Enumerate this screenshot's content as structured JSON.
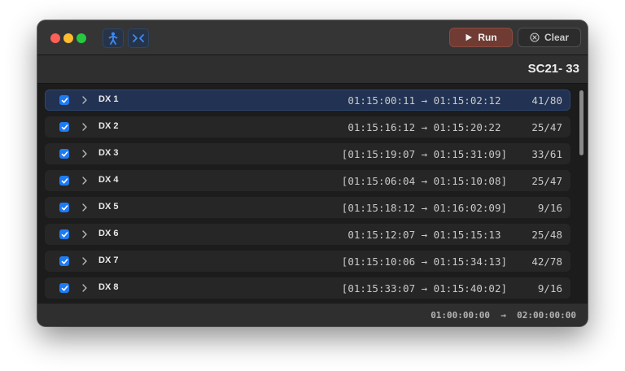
{
  "toolbar": {
    "run_label": "Run",
    "clear_label": "Clear"
  },
  "header": {
    "scene_title": "SC21- 33"
  },
  "list": {
    "rows": [
      {
        "name": "DX 1",
        "range": " 01:15:00:11 → 01:15:02:12 ",
        "count": "41/80",
        "checked": true,
        "selected": true
      },
      {
        "name": "DX 2",
        "range": " 01:15:16:12 → 01:15:20:22 ",
        "count": "25/47",
        "checked": true
      },
      {
        "name": "DX 3",
        "range": "[01:15:19:07 → 01:15:31:09]",
        "count": "33/61",
        "checked": true
      },
      {
        "name": "DX 4",
        "range": "[01:15:06:04 → 01:15:10:08]",
        "count": "25/47",
        "checked": true
      },
      {
        "name": "DX 5",
        "range": "[01:15:18:12 → 01:16:02:09]",
        "count": "9/16",
        "checked": true
      },
      {
        "name": "DX 6",
        "range": " 01:15:12:07 → 01:15:15:13 ",
        "count": "25/48",
        "checked": true
      },
      {
        "name": "DX 7",
        "range": "[01:15:10:06 → 01:15:34:13]",
        "count": "42/78",
        "checked": true
      },
      {
        "name": "DX 8",
        "range": "[01:15:33:07 → 01:15:40:02]",
        "count": "9/16",
        "checked": true
      }
    ]
  },
  "footer": {
    "range": "01:00:00:00  →  02:00:00:00"
  },
  "icons": {
    "run": "play-icon",
    "clear": "x-circle-icon",
    "toolbar_left": "figure-icon",
    "toolbar_right": "collapse-arrows-icon"
  },
  "colors": {
    "accent": "#1f7bf2",
    "run_button": "#6f3b33",
    "selected_row": "#223252"
  }
}
